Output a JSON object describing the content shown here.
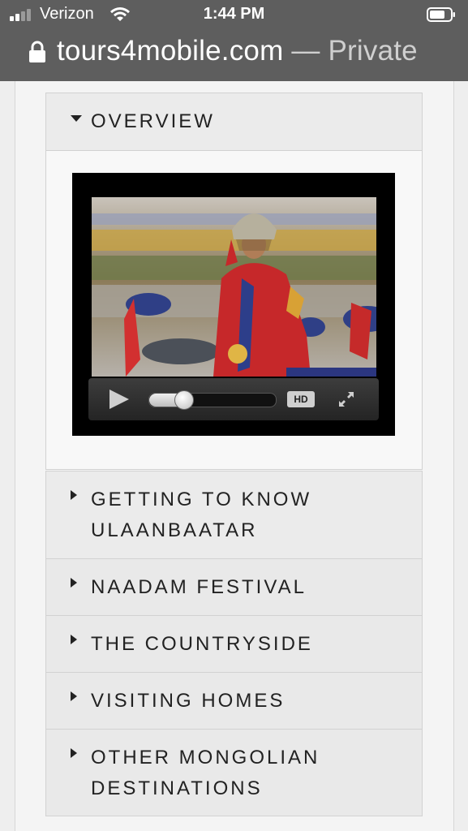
{
  "status_bar": {
    "carrier": "Verizon",
    "time": "1:44 PM"
  },
  "address_bar": {
    "domain": "tours4mobile.com",
    "suffix": "— Private"
  },
  "accordion": {
    "items": [
      {
        "label": "OVERVIEW",
        "expanded": true
      },
      {
        "label": "GETTING TO KNOW ULAANBAATAR",
        "expanded": false
      },
      {
        "label": "NAADAM FESTIVAL",
        "expanded": false
      },
      {
        "label": "THE COUNTRYSIDE",
        "expanded": false
      },
      {
        "label": "VISITING HOMES",
        "expanded": false
      },
      {
        "label": "OTHER MONGOLIAN DESTINATIONS",
        "expanded": false
      }
    ]
  },
  "video": {
    "hd_label": "HD",
    "progress_fraction": 0.27
  },
  "icons": {
    "lock": "lock-icon",
    "expanded": "caret-down-icon",
    "collapsed": "caret-right-icon",
    "play": "play-icon",
    "fullscreen": "fullscreen-icon"
  }
}
